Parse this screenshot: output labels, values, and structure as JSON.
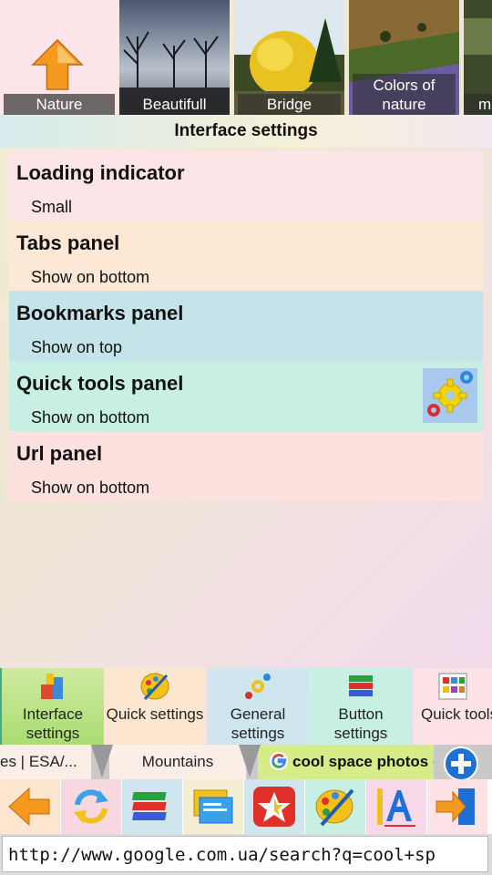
{
  "bookmarks": [
    {
      "label": "Nature"
    },
    {
      "label": "Beautifull"
    },
    {
      "label": "Bridge"
    },
    {
      "label": "Colors of nature"
    },
    {
      "label": "m"
    }
  ],
  "title": "Interface settings",
  "settings": [
    {
      "title": "Loading indicator",
      "value": "Small"
    },
    {
      "title": "Tabs panel",
      "value": "Show on bottom"
    },
    {
      "title": "Bookmarks panel",
      "value": "Show on top"
    },
    {
      "title": "Quick tools panel",
      "value": "Show on bottom"
    },
    {
      "title": "Url panel",
      "value": "Show on bottom"
    }
  ],
  "settings_tabs": [
    {
      "label": "Interface settings"
    },
    {
      "label": "Quick settings"
    },
    {
      "label": "General settings"
    },
    {
      "label": "Button settings"
    },
    {
      "label": "Quick tools panel"
    }
  ],
  "browser_tabs": [
    {
      "label": "es | ESA/..."
    },
    {
      "label": "Mountains"
    },
    {
      "label": "cool space photos -"
    }
  ],
  "url": "http://www.google.com.ua/search?q=cool+sp",
  "colors": {
    "active_tab": "#a9dd72",
    "accent_orange": "#f59a1e",
    "accent_blue": "#1e6fd6"
  }
}
